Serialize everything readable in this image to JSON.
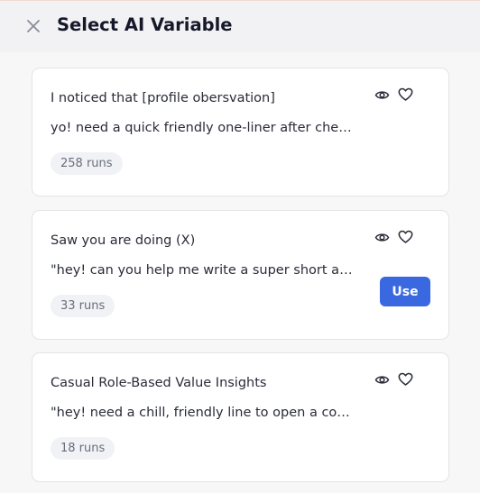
{
  "header": {
    "title": "Select AI Variable",
    "close_icon": "close-icon"
  },
  "variables": [
    {
      "title": "I noticed that [profile obersvation]",
      "description": "yo! need a quick friendly one-liner after checking out their profile",
      "runs": "258 runs",
      "show_use": false
    },
    {
      "title": "Saw you are doing (X)",
      "description": "\"hey! can you help me write a super short and friendly line",
      "runs": "33 runs",
      "show_use": true,
      "use_label": "Use"
    },
    {
      "title": "Casual Role-Based Value Insights",
      "description": "\"hey! need a chill, friendly line to open a conversation",
      "runs": "18 runs",
      "show_use": false
    }
  ],
  "icons": {
    "preview": "eye-icon",
    "favorite": "heart-icon"
  },
  "colors": {
    "accent": "#3a68e0",
    "badge_bg": "#f1f2f5",
    "header_bg": "#f2f2f4",
    "page_bg": "#f7f7f8"
  }
}
